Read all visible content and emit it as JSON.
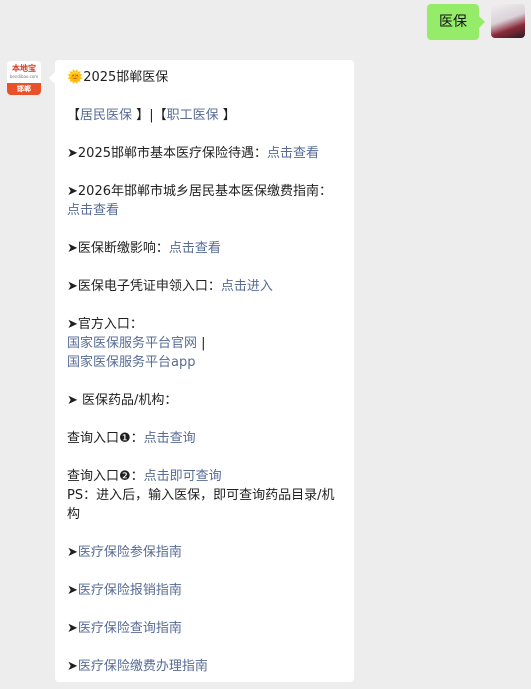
{
  "user_message": "医保",
  "bot": {
    "avatar_top": "本地宝",
    "avatar_mid": "bendibao.com",
    "avatar_bottom": "邯郸",
    "title": "2025邯郸医保",
    "sun_emoji": "🌞",
    "tabs": [
      "居民医保",
      "职工医保"
    ],
    "bracket_open": "【",
    "bracket_close": "】",
    "tab_sep": "|",
    "arrow": "➤",
    "item1_text": "2025邯郸市基本医疗保险待遇：",
    "item1_link": "点击查看",
    "item2_text": "2026年邯郸市城乡居民基本医保缴费指南：",
    "item2_link": "点击查看",
    "item3_text": "医保断缴影响：",
    "item3_link": "点击查看",
    "item4_text": "医保电子凭证申领入口：",
    "item4_link": "点击进入",
    "official_label": "官方入口：",
    "official_link1": "国家医保服务平台官网",
    "official_sep": " |",
    "official_link2": "国家医保服务平台app",
    "drug_label": " 医保药品/机构：",
    "query1_text": "查询入口❶：",
    "query1_link": "点击查询",
    "query2_text": "查询入口❷：",
    "query2_link": "点击即可查询",
    "ps_text": "PS：进入后，输入医保，即可查询药品目录/机构",
    "guides": [
      "医疗保险参保指南",
      "医疗保险报销指南",
      "医疗保险查询指南",
      "医疗保险缴费办理指南"
    ]
  },
  "colors": {
    "link": "#576b95",
    "user_bubble": "#95ec69",
    "background": "#ededed"
  }
}
